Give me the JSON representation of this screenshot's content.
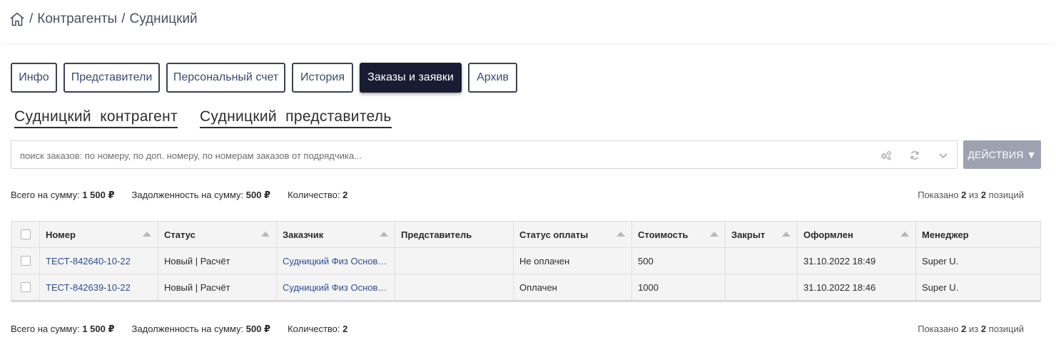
{
  "breadcrumb": {
    "items": [
      "Контрагенты",
      "Судницкий"
    ],
    "separator": "/"
  },
  "tabs": [
    {
      "label": "Инфо",
      "active": false
    },
    {
      "label": "Представители",
      "active": false
    },
    {
      "label": "Персональный счет",
      "active": false
    },
    {
      "label": "История",
      "active": false
    },
    {
      "label": "Заказы и заявки",
      "active": true
    },
    {
      "label": "Архив",
      "active": false
    }
  ],
  "entity_links": {
    "contractor": "Судницкий  контрагент",
    "representative": "Судницкий  представитель"
  },
  "search": {
    "placeholder": "поиск заказов: по номеру, по доп. номеру, по номерам заказов от подрядчика..."
  },
  "actions_button": "ДЕЙСТВИЯ ▼",
  "summary": {
    "total_label": "Всего на сумму:",
    "total_value": "1 500 ₽",
    "debt_label": "Задолженность на сумму:",
    "debt_value": "500 ₽",
    "count_label": "Количество:",
    "count_value": "2",
    "shown_prefix": "Показано",
    "shown_count": "2",
    "shown_mid": "из",
    "shown_total": "2",
    "shown_suffix": "позиций"
  },
  "table": {
    "columns": [
      "Номер",
      "Статус",
      "Заказчик",
      "Представитель",
      "Статус оплаты",
      "Стоимость",
      "Закрыт",
      "Оформлен",
      "Менеджер"
    ],
    "rows": [
      {
        "number": "ТЕСТ-842640-10-22",
        "status": "Новый | Расчёт",
        "customer": "Судницкий Физ Основной",
        "representative": "",
        "payment_status": "Не оплачен",
        "cost": "500",
        "closed": "",
        "created": "31.10.2022 18:49",
        "manager": "Super U."
      },
      {
        "number": "ТЕСТ-842639-10-22",
        "status": "Новый | Расчёт",
        "customer": "Судницкий Физ Основной",
        "representative": "",
        "payment_status": "Оплачен",
        "cost": "1000",
        "closed": "",
        "created": "31.10.2022 18:46",
        "manager": "Super U."
      }
    ]
  },
  "colors": {
    "active_tab": "#1a1c33",
    "link": "#2f4d8f",
    "actions_button": "#9ea2b0"
  }
}
